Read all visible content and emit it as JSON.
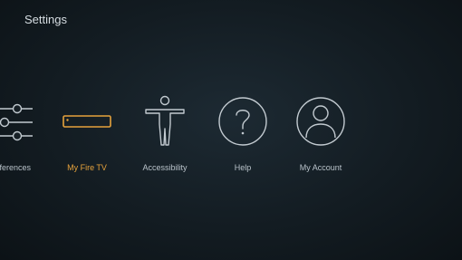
{
  "header": {
    "title": "Settings"
  },
  "menu": {
    "items": [
      {
        "label": "ferences",
        "icon": "sliders-icon"
      },
      {
        "label": "My Fire TV",
        "icon": "fire-tv-device-icon",
        "selected": true
      },
      {
        "label": "Accessibility",
        "icon": "accessibility-person-icon"
      },
      {
        "label": "Help",
        "icon": "help-question-icon"
      },
      {
        "label": "My Account",
        "icon": "account-person-icon"
      }
    ]
  },
  "colors": {
    "accent": "#e6a23c",
    "text": "#b9c3ca",
    "icon": "#c2cad0"
  }
}
